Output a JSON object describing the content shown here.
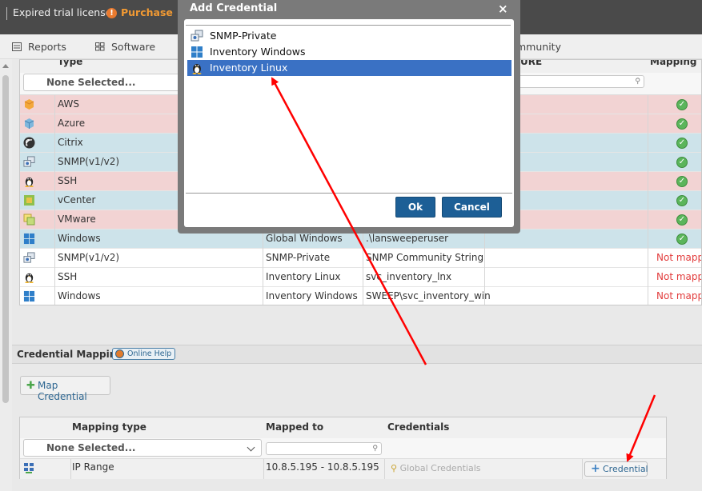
{
  "topbar": {
    "license_text": "Expired trial license",
    "purchase_icon": "!",
    "purchase_label": "Purchase"
  },
  "nav": {
    "items": [
      {
        "label": "Reports",
        "icon": "reports-icon"
      },
      {
        "label": "Software",
        "icon": "software-icon"
      },
      {
        "label": "mmunity",
        "icon": "community-icon"
      }
    ]
  },
  "credentials_table": {
    "headers": {
      "type": "Type",
      "ure": "URE",
      "mapping": "Mapping"
    },
    "filter_placeholder": "None Selected...",
    "rows": [
      {
        "type": "AWS",
        "icon": "aws-icon",
        "name": "",
        "username": "",
        "status": "check",
        "bg": "pink"
      },
      {
        "type": "Azure",
        "icon": "azure-icon",
        "name": "",
        "username": "",
        "status": "check",
        "bg": "pink"
      },
      {
        "type": "Citrix",
        "icon": "citrix-icon",
        "name": "",
        "username": "",
        "status": "check",
        "bg": "blue"
      },
      {
        "type": "SNMP(v1/v2)",
        "icon": "snmp-icon",
        "name": "",
        "username": "",
        "status": "check",
        "bg": "blue"
      },
      {
        "type": "SSH",
        "icon": "linux-icon",
        "name": "",
        "username": "",
        "status": "check",
        "bg": "pink"
      },
      {
        "type": "vCenter",
        "icon": "vcenter-icon",
        "name": "",
        "username": "",
        "status": "check",
        "bg": "blue"
      },
      {
        "type": "VMware",
        "icon": "vmware-icon",
        "name": "",
        "username": "",
        "status": "check",
        "bg": "pink"
      },
      {
        "type": "Windows",
        "icon": "windows-icon",
        "name": "Global Windows",
        "username": ".\\lansweeperuser",
        "status": "check",
        "bg": "blue"
      },
      {
        "type": "SNMP(v1/v2)",
        "icon": "snmp-icon",
        "name": "SNMP-Private",
        "username": "SNMP Community String",
        "status": "Not mappe",
        "bg": "white"
      },
      {
        "type": "SSH",
        "icon": "linux-icon",
        "name": "Inventory Linux",
        "username": "svc_inventory_lnx",
        "status": "Not mappe",
        "bg": "white"
      },
      {
        "type": "Windows",
        "icon": "windows-icon",
        "name": "Inventory Windows",
        "username": "SWEEP\\svc_inventory_win",
        "status": "Not mappe",
        "bg": "white"
      }
    ]
  },
  "credential_mapping": {
    "title": "Credential Mapping",
    "help_label": "Online Help",
    "map_button": "Map Credential",
    "headers": {
      "mapping_type": "Mapping type",
      "mapped_to": "Mapped to",
      "credentials": "Credentials"
    },
    "filter_placeholder": "None Selected...",
    "row": {
      "mapping_type": "IP Range",
      "mapped_to": "10.8.5.195 - 10.8.5.195",
      "credentials": "Global Credentials",
      "add_button": "Credential"
    }
  },
  "modal": {
    "title": "Add Credential",
    "close": "×",
    "items": [
      {
        "label": "SNMP-Private",
        "icon": "snmp-icon",
        "selected": false
      },
      {
        "label": "Inventory Windows",
        "icon": "windows-icon",
        "selected": false
      },
      {
        "label": "Inventory Linux",
        "icon": "linux-icon",
        "selected": true
      }
    ],
    "ok_label": "Ok",
    "cancel_label": "Cancel"
  },
  "colors": {
    "selected": "#3a71c4",
    "button": "#1d5f96",
    "not_mapped": "#e23d3d",
    "check": "#5bb55b",
    "annotation_arrow": "#ff0000"
  }
}
